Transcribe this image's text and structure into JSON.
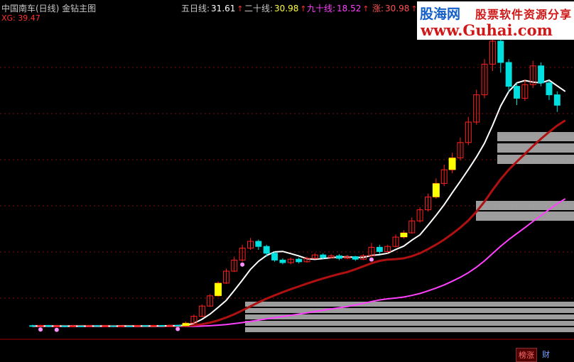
{
  "header": {
    "title": "中国南车(日线) 金钻主图",
    "xg_label": "XG: 39.47",
    "ma5_label": "五日线:",
    "ma5_value": "31.61",
    "ma20_label": "二十线:",
    "ma20_value": "30.98",
    "ma90_label": "九十线:",
    "ma90_value": "18.52",
    "zhang_label": "涨:",
    "zhang_value": "30.98",
    "arrow": "↑"
  },
  "watermark": {
    "brand": "股海网",
    "slogan": "股票软件资源分享",
    "url": "www.Guhai.com"
  },
  "tabs": {
    "bang": "榜涨",
    "cai": "财"
  },
  "colors": {
    "background": "#000000",
    "up": "#ff2020",
    "down": "#00e0e0",
    "ma5": "#ffffff",
    "ma20": "#b01010",
    "ma90": "#ff40ff",
    "breakout": "#ffff00"
  },
  "chart_data": {
    "type": "candlestick",
    "title": "中国南车(日线) 金钻主图",
    "ylim": [
      2.5,
      40
    ],
    "grid": "dotted-horizontal",
    "candles": [
      {
        "o": 5.1,
        "c": 5.05,
        "h": 5.2,
        "l": 4.95
      },
      {
        "o": 5.05,
        "c": 5.12,
        "h": 5.2,
        "l": 4.98
      },
      {
        "o": 5.12,
        "c": 5.0,
        "h": 5.18,
        "l": 4.92
      },
      {
        "o": 5.0,
        "c": 5.08,
        "h": 5.15,
        "l": 4.95
      },
      {
        "o": 5.08,
        "c": 4.98,
        "h": 5.12,
        "l": 4.9
      },
      {
        "o": 4.98,
        "c": 5.06,
        "h": 5.12,
        "l": 4.92
      },
      {
        "o": 5.06,
        "c": 5.0,
        "h": 5.1,
        "l": 4.94
      },
      {
        "o": 5.0,
        "c": 5.1,
        "h": 5.16,
        "l": 4.95
      },
      {
        "o": 5.1,
        "c": 5.02,
        "h": 5.15,
        "l": 4.96
      },
      {
        "o": 5.02,
        "c": 5.08,
        "h": 5.12,
        "l": 4.96
      },
      {
        "o": 5.08,
        "c": 5.0,
        "h": 5.12,
        "l": 4.94
      },
      {
        "o": 5.0,
        "c": 5.06,
        "h": 5.1,
        "l": 4.95
      },
      {
        "o": 5.06,
        "c": 5.02,
        "h": 5.1,
        "l": 4.96
      },
      {
        "o": 5.02,
        "c": 5.1,
        "h": 5.16,
        "l": 4.98
      },
      {
        "o": 5.1,
        "c": 5.04,
        "h": 5.14,
        "l": 4.98
      },
      {
        "o": 5.04,
        "c": 5.12,
        "h": 5.18,
        "l": 5.0
      },
      {
        "o": 5.12,
        "c": 5.06,
        "h": 5.16,
        "l": 5.0
      },
      {
        "o": 5.06,
        "c": 5.14,
        "h": 5.2,
        "l": 5.02
      },
      {
        "o": 5.14,
        "c": 5.1,
        "h": 5.2,
        "l": 5.04
      },
      {
        "o": 5.1,
        "c": 5.4,
        "h": 5.6,
        "l": 5.05
      },
      {
        "o": 5.4,
        "c": 6.2,
        "h": 6.4,
        "l": 5.35
      },
      {
        "o": 6.2,
        "c": 7.4,
        "h": 7.6,
        "l": 6.1
      },
      {
        "o": 7.4,
        "c": 8.6,
        "h": 8.8,
        "l": 7.3
      },
      {
        "o": 8.6,
        "c": 10.1,
        "h": 10.3,
        "l": 8.5
      },
      {
        "o": 10.1,
        "c": 11.5,
        "h": 11.8,
        "l": 10.0
      },
      {
        "o": 11.5,
        "c": 12.8,
        "h": 13.2,
        "l": 11.4
      },
      {
        "o": 12.8,
        "c": 14.2,
        "h": 14.6,
        "l": 12.6
      },
      {
        "o": 14.2,
        "c": 15.0,
        "h": 15.4,
        "l": 14.0
      },
      {
        "o": 15.0,
        "c": 14.4,
        "h": 15.2,
        "l": 14.0
      },
      {
        "o": 14.4,
        "c": 13.6,
        "h": 14.6,
        "l": 13.2
      },
      {
        "o": 13.6,
        "c": 12.8,
        "h": 13.8,
        "l": 12.6
      },
      {
        "o": 12.8,
        "c": 12.5,
        "h": 13.0,
        "l": 12.3
      },
      {
        "o": 12.5,
        "c": 12.9,
        "h": 13.1,
        "l": 12.3
      },
      {
        "o": 12.9,
        "c": 12.6,
        "h": 13.1,
        "l": 12.4
      },
      {
        "o": 12.6,
        "c": 13.0,
        "h": 13.2,
        "l": 12.5
      },
      {
        "o": 13.0,
        "c": 13.4,
        "h": 13.6,
        "l": 12.9
      },
      {
        "o": 13.4,
        "c": 13.1,
        "h": 13.6,
        "l": 12.9
      },
      {
        "o": 13.1,
        "c": 13.3,
        "h": 13.5,
        "l": 13.0
      },
      {
        "o": 13.3,
        "c": 13.0,
        "h": 13.5,
        "l": 12.8
      },
      {
        "o": 13.0,
        "c": 13.2,
        "h": 13.4,
        "l": 12.9
      },
      {
        "o": 13.2,
        "c": 12.9,
        "h": 13.3,
        "l": 12.7
      },
      {
        "o": 12.9,
        "c": 13.3,
        "h": 13.5,
        "l": 12.8
      },
      {
        "o": 13.3,
        "c": 14.3,
        "h": 14.8,
        "l": 13.2
      },
      {
        "o": 14.3,
        "c": 13.8,
        "h": 14.6,
        "l": 13.5
      },
      {
        "o": 13.8,
        "c": 14.4,
        "h": 14.6,
        "l": 13.6
      },
      {
        "o": 14.4,
        "c": 15.5,
        "h": 15.8,
        "l": 14.3
      },
      {
        "o": 15.5,
        "c": 16.0,
        "h": 16.3,
        "l": 15.3
      },
      {
        "o": 16.0,
        "c": 17.4,
        "h": 17.8,
        "l": 15.9
      },
      {
        "o": 17.4,
        "c": 18.7,
        "h": 19.0,
        "l": 17.2
      },
      {
        "o": 18.7,
        "c": 20.2,
        "h": 20.6,
        "l": 18.5
      },
      {
        "o": 20.2,
        "c": 21.8,
        "h": 22.4,
        "l": 20.0
      },
      {
        "o": 21.8,
        "c": 23.4,
        "h": 24.0,
        "l": 21.5
      },
      {
        "o": 23.4,
        "c": 24.8,
        "h": 25.4,
        "l": 23.0
      },
      {
        "o": 24.8,
        "c": 26.6,
        "h": 27.2,
        "l": 24.5
      },
      {
        "o": 26.6,
        "c": 29.0,
        "h": 29.6,
        "l": 26.3
      },
      {
        "o": 29.0,
        "c": 32.2,
        "h": 32.8,
        "l": 28.7
      },
      {
        "o": 32.2,
        "c": 35.8,
        "h": 36.4,
        "l": 31.8
      },
      {
        "o": 35.8,
        "c": 38.5,
        "h": 39.47,
        "l": 35.0
      },
      {
        "o": 38.5,
        "c": 36.0,
        "h": 38.8,
        "l": 34.8
      },
      {
        "o": 36.0,
        "c": 33.2,
        "h": 36.4,
        "l": 32.5
      },
      {
        "o": 33.2,
        "c": 31.8,
        "h": 33.6,
        "l": 31.0
      },
      {
        "o": 31.8,
        "c": 33.4,
        "h": 34.0,
        "l": 31.5
      },
      {
        "o": 33.4,
        "c": 35.6,
        "h": 36.2,
        "l": 33.0
      },
      {
        "o": 35.6,
        "c": 33.6,
        "h": 36.0,
        "l": 33.2
      },
      {
        "o": 33.6,
        "c": 32.2,
        "h": 33.9,
        "l": 31.6
      },
      {
        "o": 32.2,
        "c": 30.98,
        "h": 32.6,
        "l": 30.2
      }
    ],
    "ma5": [
      5.05,
      5.06,
      5.05,
      5.05,
      5.05,
      5.04,
      5.04,
      5.05,
      5.05,
      5.05,
      5.04,
      5.05,
      5.05,
      5.05,
      5.06,
      5.07,
      5.07,
      5.09,
      5.09,
      5.16,
      5.38,
      5.84,
      6.46,
      7.24,
      8.06,
      9.24,
      10.44,
      11.7,
      12.66,
      13.34,
      13.76,
      13.82,
      13.56,
      13.28,
      12.96,
      12.88,
      12.98,
      13.08,
      13.16,
      13.2,
      13.1,
      13.12,
      13.34,
      13.44,
      13.6,
      14.04,
      14.44,
      15.14,
      15.76,
      16.88,
      18.06,
      19.3,
      20.7,
      22.06,
      23.44,
      24.9,
      26.52,
      28.62,
      30.9,
      32.58,
      33.6,
      33.88,
      33.7,
      33.6,
      33.92,
      33.26,
      32.6
    ],
    "ma20": [
      5.05,
      5.05,
      5.05,
      5.05,
      5.05,
      5.05,
      5.05,
      5.05,
      5.05,
      5.05,
      5.05,
      5.05,
      5.05,
      5.05,
      5.05,
      5.05,
      5.05,
      5.05,
      5.06,
      5.07,
      5.14,
      5.27,
      5.46,
      5.72,
      6.05,
      6.44,
      6.89,
      7.37,
      7.84,
      8.27,
      8.66,
      9.03,
      9.38,
      9.71,
      10.03,
      10.35,
      10.64,
      10.91,
      11.17,
      11.39,
      11.72,
      12.07,
      12.43,
      12.71,
      12.86,
      12.91,
      13.01,
      13.26,
      13.6,
      14.08,
      14.62,
      15.2,
      15.88,
      16.62,
      17.46,
      18.48,
      19.66,
      21.02,
      22.3,
      23.4,
      24.36,
      25.26,
      26.18,
      27.04,
      27.84,
      28.58,
      29.2
    ]
  }
}
